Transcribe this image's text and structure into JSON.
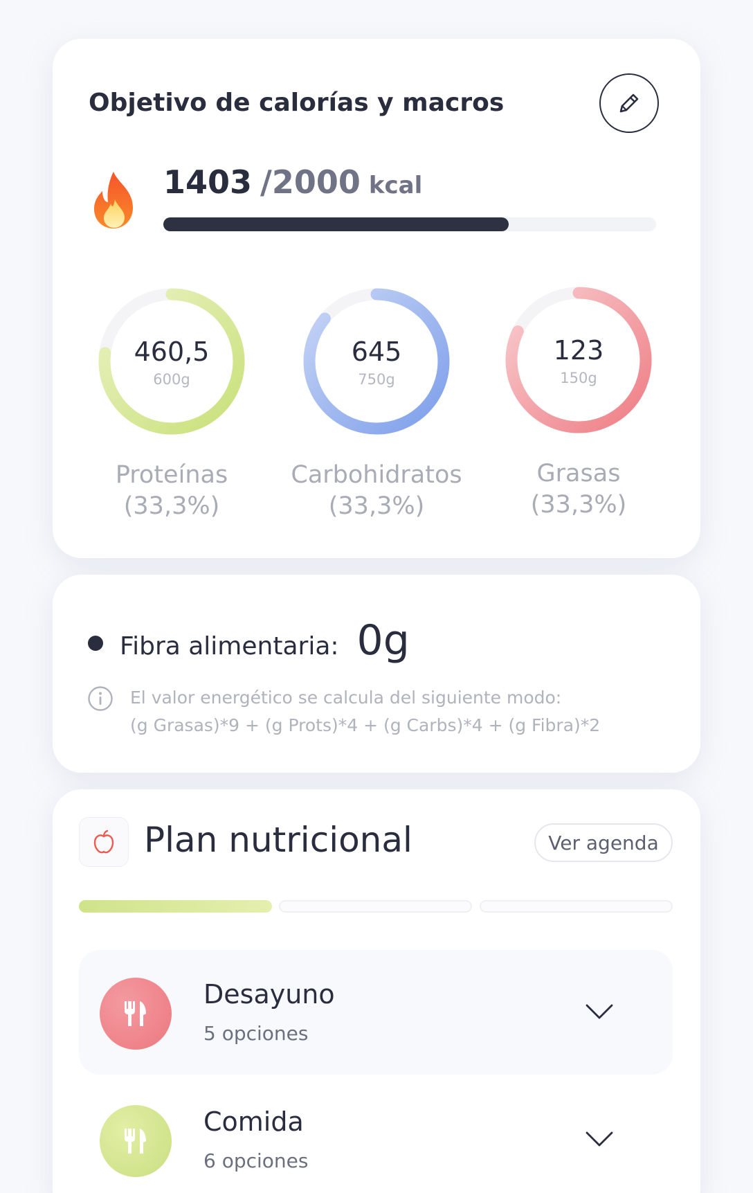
{
  "calories_card": {
    "title": "Objetivo de calorías y macros",
    "edit_icon": "pencil-icon",
    "fire_icon": "fire-icon",
    "current_kcal": "1403",
    "goal_kcal": "/2000",
    "unit": "kcal",
    "progress": 0.7015,
    "macros": [
      {
        "value": "460,5",
        "goal": "600g",
        "name": "Proteínas",
        "percent": "(33,3%)",
        "progress": 0.77,
        "color_start": "#c9e07a",
        "color_end": "#eaf2c2"
      },
      {
        "value": "645",
        "goal": "750g",
        "name": "Carbohidratos",
        "percent": "(33,3%)",
        "progress": 0.86,
        "color_start": "#7d9eea",
        "color_end": "#c8d6f6"
      },
      {
        "value": "123",
        "goal": "150g",
        "name": "Grasas",
        "percent": "(33,3%)",
        "progress": 0.82,
        "color_start": "#ee7d84",
        "color_end": "#f8cdd0"
      }
    ]
  },
  "fiber_card": {
    "label": "Fibra alimentaria:",
    "value": "0g",
    "info_icon": "info-icon",
    "info_line1": "El valor energético se calcula del siguiente modo:",
    "info_line2": "(g Grasas)*9 + (g Prots)*4 + (g Carbs)*4 + (g Fibra)*2"
  },
  "plan_card": {
    "title": "Plan nutricional",
    "apple_icon": "apple-icon",
    "agenda_button": "Ver agenda",
    "active_step": 1,
    "step_count": 3,
    "meals": [
      {
        "name": "Desayuno",
        "options": "5 opciones",
        "color": "#ef7f86",
        "icon": "cutlery-icon"
      },
      {
        "name": "Comida",
        "options": "6 opciones",
        "color": "#cfe386",
        "icon": "cutlery-icon"
      }
    ]
  }
}
